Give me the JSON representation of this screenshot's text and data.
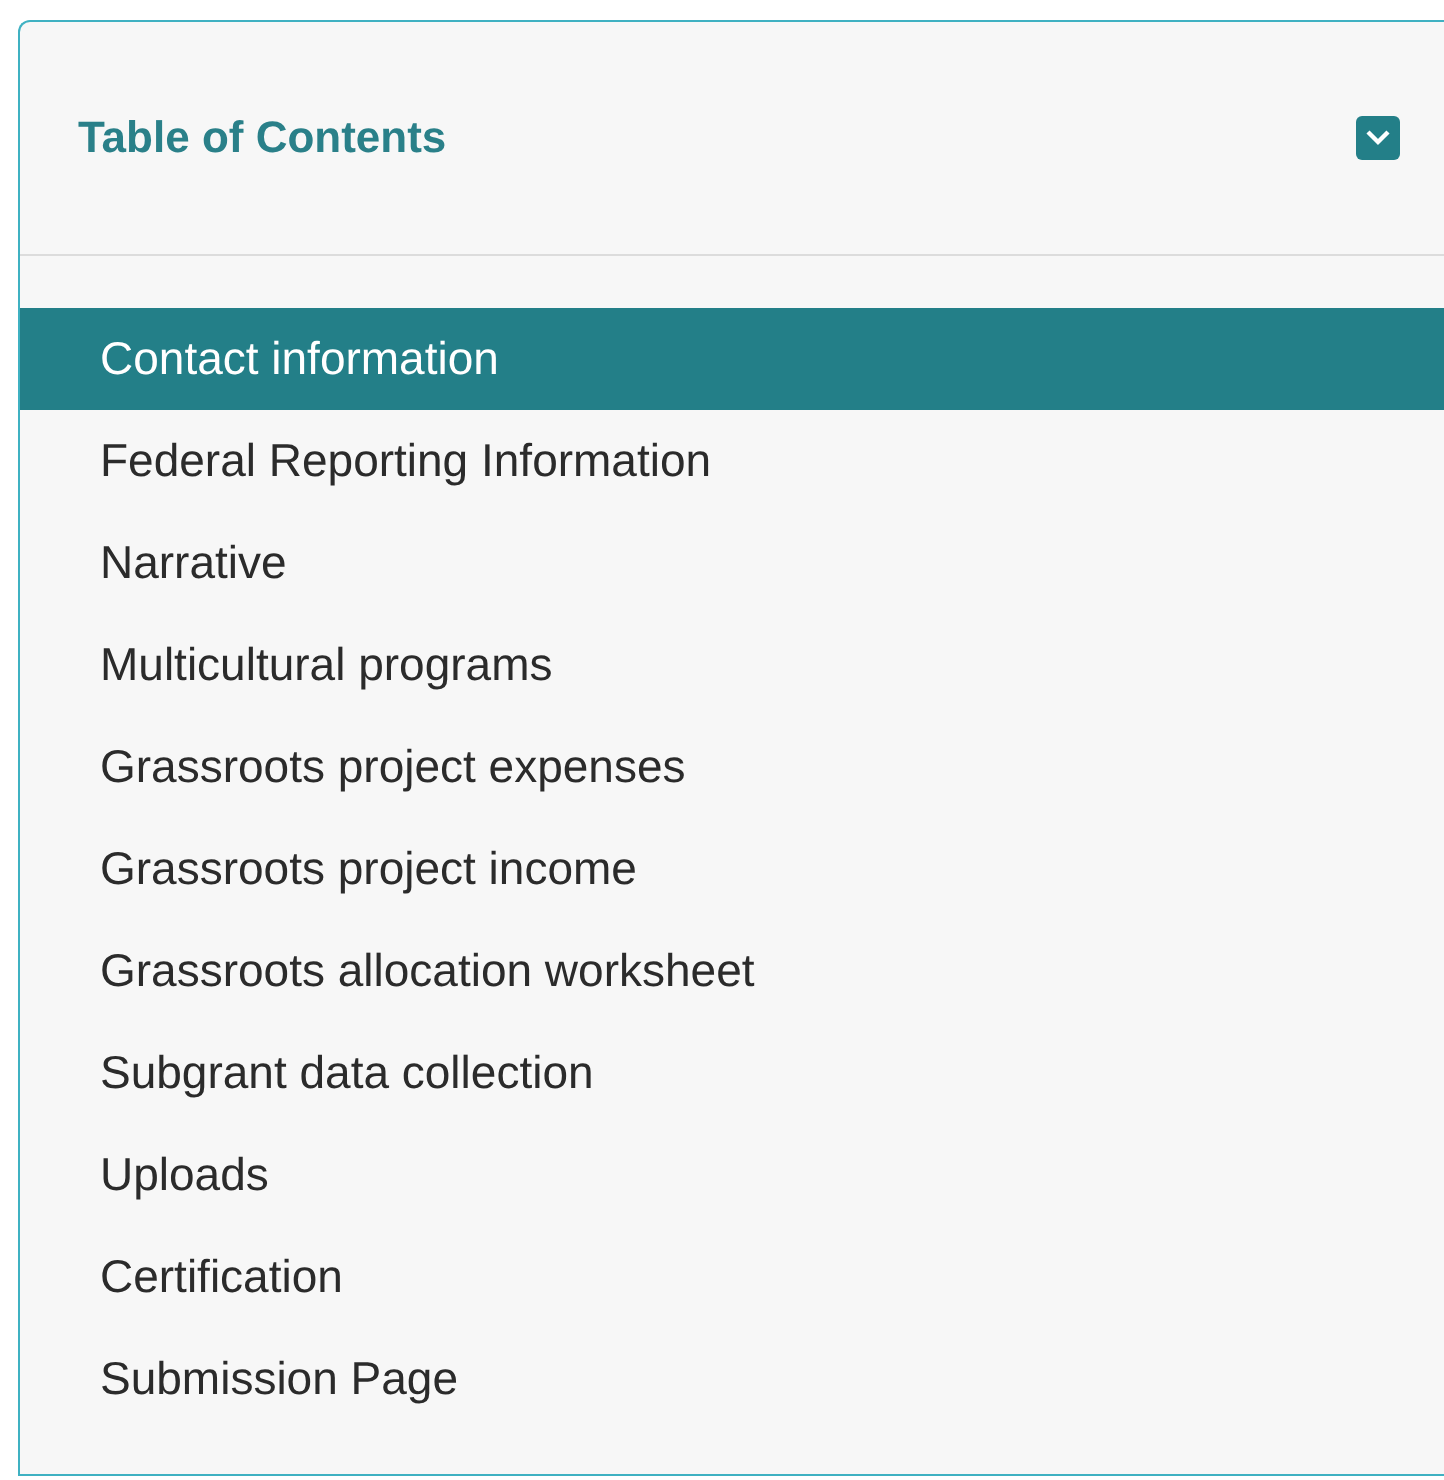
{
  "panel": {
    "title": "Table of Contents",
    "expanded": true
  },
  "items": [
    {
      "label": "Contact information",
      "selected": true
    },
    {
      "label": "Federal Reporting Information",
      "selected": false
    },
    {
      "label": "Narrative",
      "selected": false
    },
    {
      "label": "Multicultural programs",
      "selected": false
    },
    {
      "label": "Grassroots project expenses",
      "selected": false
    },
    {
      "label": "Grassroots project income",
      "selected": false
    },
    {
      "label": "Grassroots allocation worksheet",
      "selected": false
    },
    {
      "label": "Subgrant data collection",
      "selected": false
    },
    {
      "label": "Uploads",
      "selected": false
    },
    {
      "label": "Certification",
      "selected": false
    },
    {
      "label": "Submission Page",
      "selected": false
    }
  ]
}
